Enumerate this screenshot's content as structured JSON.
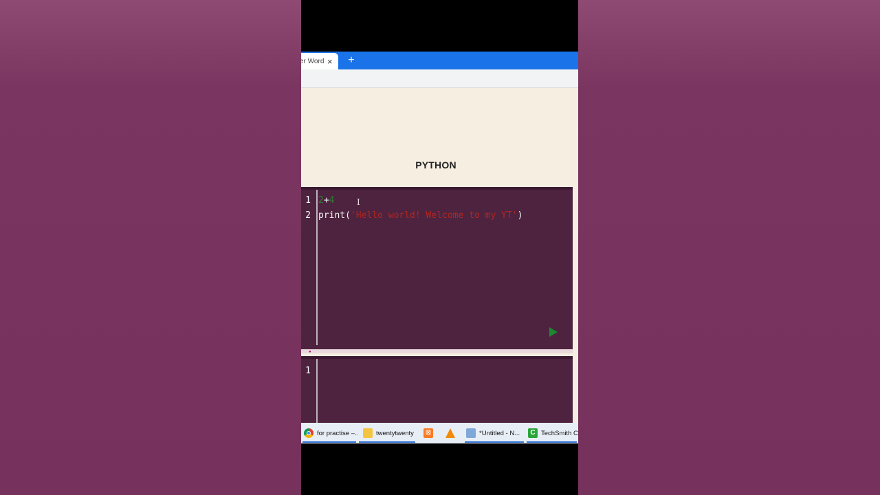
{
  "browser": {
    "tab_title": "er Word!",
    "tab_close": "×",
    "new_tab": "+"
  },
  "page": {
    "title": "PYTHON"
  },
  "editor1": {
    "lines": [
      {
        "number": "1",
        "num_a": "2",
        "op": "+",
        "num_b": "4"
      },
      {
        "number": "2",
        "func": "print(",
        "string": "'Hello world! Welcome to my YT'",
        "close": ")"
      }
    ]
  },
  "editor2": {
    "lines": [
      {
        "number": "1"
      }
    ]
  },
  "taskbar": {
    "items": [
      {
        "label": "for practise –...",
        "icon": "chrome-icon"
      },
      {
        "label": "twentytwenty",
        "icon": "folder-icon"
      },
      {
        "label": "",
        "icon": "xampp-icon"
      },
      {
        "label": "",
        "icon": "vlc-icon"
      },
      {
        "label": "*Untitled - N...",
        "icon": "notepad-icon"
      },
      {
        "label": "TechSmith C",
        "icon": "camtasia-icon"
      }
    ]
  },
  "colors": {
    "tab_bar": "#1a73e8",
    "page_bg": "#f5eee1",
    "editor_bg": "#4e2340",
    "number": "#2e7d32",
    "string": "#b3261e",
    "run": "#1b8a2e"
  }
}
